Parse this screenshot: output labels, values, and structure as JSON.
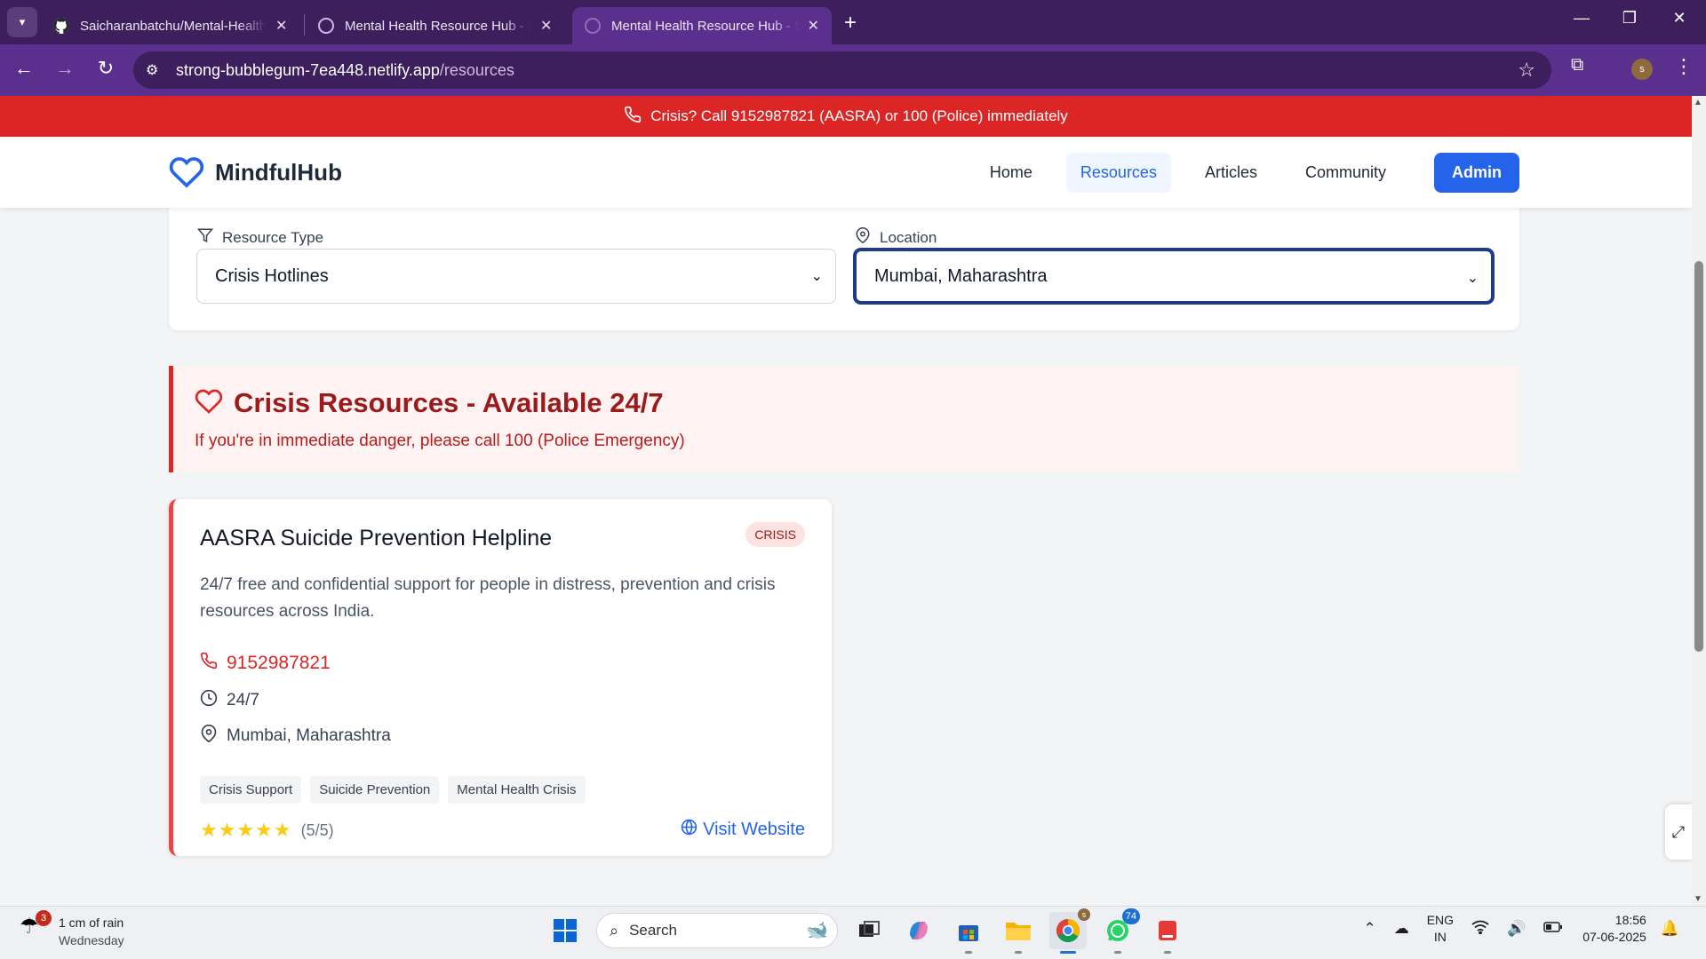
{
  "browser": {
    "tabs": [
      {
        "title": "Saicharanbatchu/Mental-Health-Resource-Hub"
      },
      {
        "title": "Mental Health Resource Hub - Supp"
      },
      {
        "title": "Mental Health Resource Hub - Supp"
      }
    ],
    "url_host": "strong-bubblegum-7ea448.netlify.app",
    "url_path": "/resources",
    "profile_initial": "s"
  },
  "crisis_banner": {
    "text": "Crisis? Call 9152987821 (AASRA) or 100 (Police) immediately"
  },
  "header": {
    "logo": "MindfulHub",
    "nav": [
      "Home",
      "Resources",
      "Articles",
      "Community",
      "Admin"
    ]
  },
  "filters": {
    "type_label": "Resource Type",
    "type_value": "Crisis Hotlines",
    "location_label": "Location",
    "location_value": "Mumbai, Maharashtra"
  },
  "crisis_section": {
    "title": "Crisis Resources - Available 24/7",
    "subtitle": "If you're in immediate danger, please call 100 (Police Emergency)"
  },
  "resource": {
    "name": "AASRA Suicide Prevention Helpline",
    "badge": "CRISIS",
    "description": "24/7 free and confidential support for people in distress, prevention and crisis resources across India.",
    "phone": "9152987821",
    "hours": "24/7",
    "location": "Mumbai, Maharashtra",
    "tags": [
      "Crisis Support",
      "Suicide Prevention",
      "Mental Health Crisis"
    ],
    "rating": 5,
    "rating_text": "(5/5)",
    "website_label": "Visit Website"
  },
  "taskbar": {
    "weather_title": "1 cm of rain",
    "weather_sub": "Wednesday",
    "weather_badge": "3",
    "search_placeholder": "Search",
    "whatsapp_badge": "74",
    "lang_top": "ENG",
    "lang_bottom": "IN",
    "time": "18:56",
    "date": "07-06-2025"
  },
  "colors": {
    "brand": "#2563eb",
    "crisis": "#dc2626",
    "browser_frame": "#5b2f8e"
  }
}
